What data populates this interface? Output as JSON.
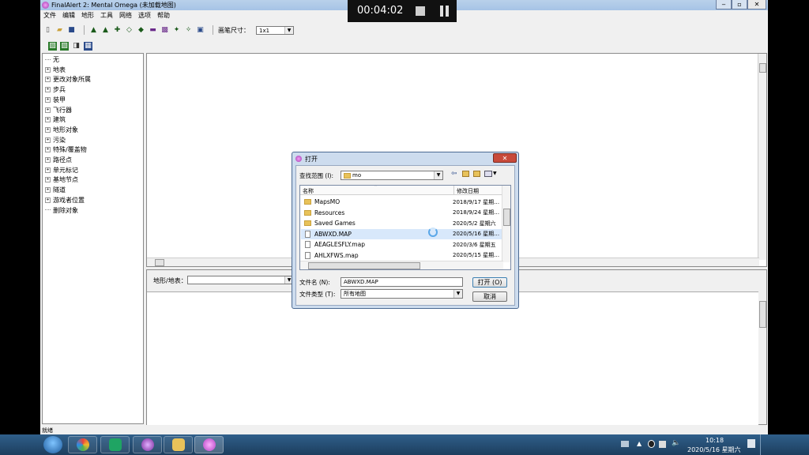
{
  "app": {
    "title": "FinalAlert 2: Mental Omega (未加载地图)",
    "menu": [
      "文件",
      "编辑",
      "地形",
      "工具",
      "网络",
      "选项",
      "帮助"
    ],
    "brush_label": "画笔尺寸：",
    "brush_value": "1x1",
    "tree": [
      "无",
      "地表",
      "更改对象所属",
      "步兵",
      "装甲",
      "飞行器",
      "建筑",
      "地形对象",
      "污染",
      "特殊/覆盖物",
      "路径点",
      "单元标记",
      "基地节点",
      "隧道",
      "游戏者位置",
      "删除对象"
    ],
    "tree_expandable": [
      false,
      true,
      true,
      true,
      true,
      true,
      true,
      true,
      true,
      true,
      true,
      true,
      true,
      true,
      true,
      false
    ],
    "terrain_label": "地形/地表：",
    "status": "就绪"
  },
  "dialog": {
    "title": "打开",
    "lookin_label": "查找范围 (I):",
    "lookin_value": "mo",
    "col_name": "名称",
    "col_date": "修改日期",
    "files": [
      {
        "name": "MapsMO",
        "date": "2018/9/17 星期…",
        "type": "folder"
      },
      {
        "name": "Resources",
        "date": "2018/9/24 星期…",
        "type": "folder"
      },
      {
        "name": "Saved Games",
        "date": "2020/5/2 星期六",
        "type": "folder"
      },
      {
        "name": "ABWXD.MAP",
        "date": "2020/5/16 星期…",
        "type": "file"
      },
      {
        "name": "AEAGLESFLY.map",
        "date": "2020/3/6 星期五",
        "type": "file"
      },
      {
        "name": "AHLXFWS.map",
        "date": "2020/5/15 星期…",
        "type": "file"
      }
    ],
    "selected_index": 3,
    "filename_label": "文件名 (N):",
    "filename_value": "ABWXD.MAP",
    "filetype_label": "文件类型 (T):",
    "filetype_value": "所有地图",
    "open_button": "打开 (O)",
    "cancel_button": "取消"
  },
  "recorder": {
    "time": "00:04:02"
  },
  "taskbar": {
    "time": "10:18",
    "date": "2020/5/16 星期六"
  }
}
